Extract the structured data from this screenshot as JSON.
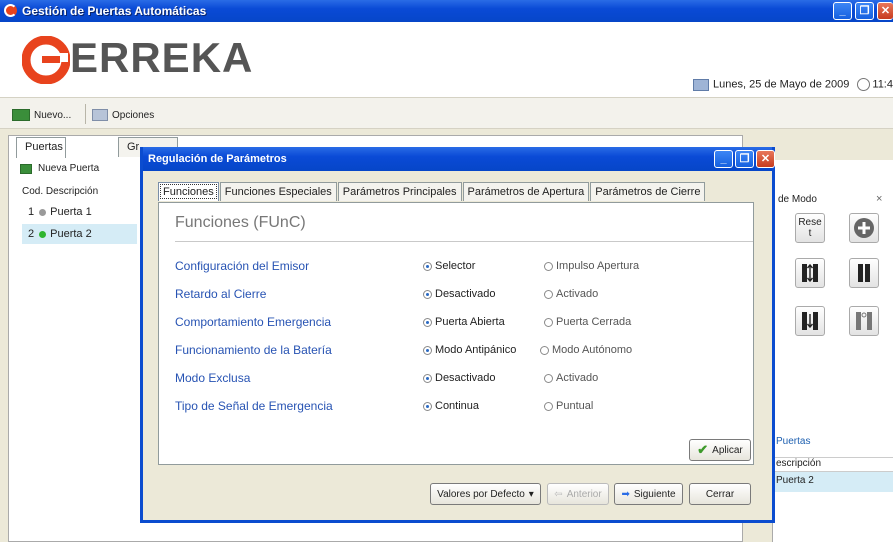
{
  "window": {
    "title": "Gestión de Puertas Automáticas",
    "controls": {
      "minimize": "_",
      "maximize": "❐",
      "close": "✕"
    }
  },
  "header": {
    "logo_text": "ERREKA",
    "date": "Lunes, 25 de Mayo de 2009",
    "time": "11:4"
  },
  "toolbar": {
    "new_label": "Nuevo...",
    "options_label": "Opciones"
  },
  "left": {
    "tabs": [
      "Puertas",
      "Gr"
    ],
    "new_door_label": "Nueva Puerta",
    "columns": {
      "cod": "Cod.",
      "desc": "Descripción"
    },
    "rows": [
      {
        "cod": "1",
        "name": "Puerta 1",
        "status_color": "#9a9a9a"
      },
      {
        "cod": "2",
        "name": "Puerta 2",
        "status_color": "#2fb52f"
      }
    ]
  },
  "right": {
    "mode_title": "de Modo",
    "close": "×",
    "reset_label": "Rese t",
    "puertas_title": "Puertas",
    "col_desc": "escripción",
    "row_value": "Puerta 2"
  },
  "dialog": {
    "title": "Regulación de Parámetros",
    "tabs": [
      "Funciones",
      "Funciones Especiales",
      "Parámetros Principales",
      "Parámetros de Apertura",
      "Parámetros de Cierre"
    ],
    "section_title": "Funciones (FUnC)",
    "params": [
      {
        "label": "Configuración del Emisor",
        "opt1": "Selector",
        "opt2": "Impulso Apertura",
        "selected": 1
      },
      {
        "label": "Retardo al Cierre",
        "opt1": "Desactivado",
        "opt2": "Activado",
        "selected": 1
      },
      {
        "label": "Comportamiento Emergencia",
        "opt1": "Puerta Abierta",
        "opt2": "Puerta Cerrada",
        "selected": 1
      },
      {
        "label": "Funcionamiento de la Batería",
        "opt1": "Modo Antipánico",
        "opt2": "Modo Autónomo",
        "selected": 1
      },
      {
        "label": "Modo Exclusa",
        "opt1": "Desactivado",
        "opt2": "Activado",
        "selected": 1
      },
      {
        "label": "Tipo de Señal de Emergencia",
        "opt1": "Continua",
        "opt2": "Puntual",
        "selected": 1
      }
    ],
    "buttons": {
      "apply": "Aplicar",
      "defaults": "Valores por Defecto",
      "prev": "Anterior",
      "next": "Siguiente",
      "close": "Cerrar"
    }
  },
  "colors": {
    "titlebar": "#0a4ad6",
    "label_blue": "#2753b3",
    "selection": "#d5ecf6",
    "logo_red": "#e8431d"
  }
}
